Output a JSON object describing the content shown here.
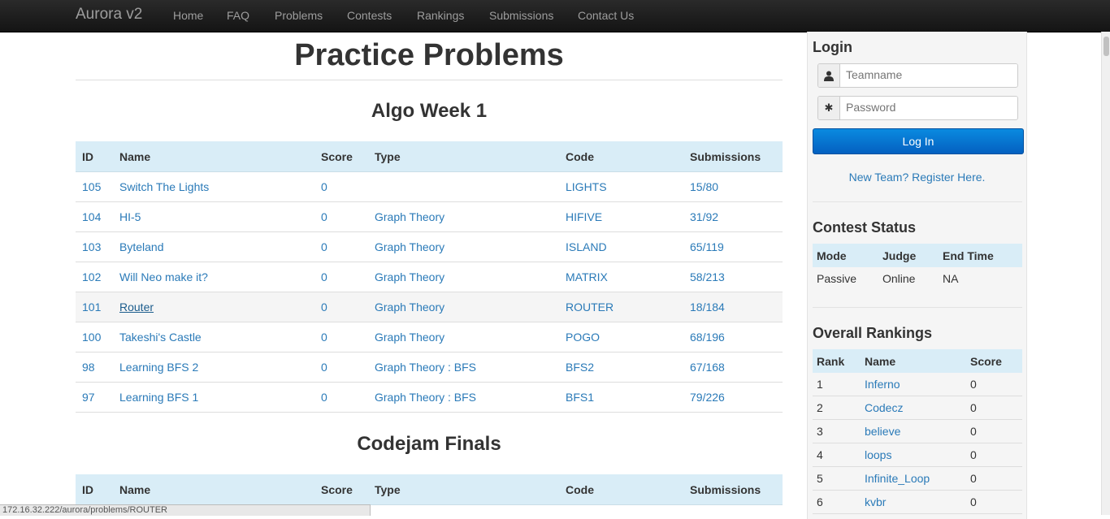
{
  "navbar": {
    "brand": "Aurora v2",
    "items": [
      "Home",
      "FAQ",
      "Problems",
      "Contests",
      "Rankings",
      "Submissions",
      "Contact Us"
    ]
  },
  "main": {
    "title": "Practice Problems",
    "columns": [
      "ID",
      "Name",
      "Score",
      "Type",
      "Code",
      "Submissions"
    ],
    "sections": [
      {
        "title": "Algo Week 1",
        "rows": [
          {
            "id": "105",
            "name": "Switch The Lights",
            "score": "0",
            "type": "",
            "code": "LIGHTS",
            "subs": "15/80"
          },
          {
            "id": "104",
            "name": "HI-5",
            "score": "0",
            "type": "Graph Theory",
            "code": "HIFIVE",
            "subs": "31/92"
          },
          {
            "id": "103",
            "name": "Byteland",
            "score": "0",
            "type": "Graph Theory",
            "code": "ISLAND",
            "subs": "65/119"
          },
          {
            "id": "102",
            "name": "Will Neo make it?",
            "score": "0",
            "type": "Graph Theory",
            "code": "MATRIX",
            "subs": "58/213"
          },
          {
            "id": "101",
            "name": "Router",
            "score": "0",
            "type": "Graph Theory",
            "code": "ROUTER",
            "subs": "18/184"
          },
          {
            "id": "100",
            "name": "Takeshi's Castle",
            "score": "0",
            "type": "Graph Theory",
            "code": "POGO",
            "subs": "68/196"
          },
          {
            "id": "98",
            "name": "Learning BFS 2",
            "score": "0",
            "type": "Graph Theory : BFS",
            "code": "BFS2",
            "subs": "67/168"
          },
          {
            "id": "97",
            "name": "Learning BFS 1",
            "score": "0",
            "type": "Graph Theory : BFS",
            "code": "BFS1",
            "subs": "79/226"
          }
        ]
      },
      {
        "title": "Codejam Finals",
        "rows": []
      }
    ]
  },
  "sidebar": {
    "login": {
      "heading": "Login",
      "teamname_placeholder": "Teamname",
      "password_placeholder": "Password",
      "button": "Log In",
      "register": "New Team? Register Here."
    },
    "contest_status": {
      "heading": "Contest Status",
      "columns": [
        "Mode",
        "Judge",
        "End Time"
      ],
      "values": [
        "Passive",
        "Online",
        "NA"
      ]
    },
    "rankings": {
      "heading": "Overall Rankings",
      "columns": [
        "Rank",
        "Name",
        "Score"
      ],
      "rows": [
        {
          "rank": "1",
          "name": "Inferno",
          "score": "0"
        },
        {
          "rank": "2",
          "name": "Codecz",
          "score": "0"
        },
        {
          "rank": "3",
          "name": "believe",
          "score": "0"
        },
        {
          "rank": "4",
          "name": "loops",
          "score": "0"
        },
        {
          "rank": "5",
          "name": "Infinite_Loop",
          "score": "0"
        },
        {
          "rank": "6",
          "name": "kvbr",
          "score": "0"
        }
      ]
    }
  },
  "status_url": "172.16.32.222/aurora/problems/ROUTER"
}
